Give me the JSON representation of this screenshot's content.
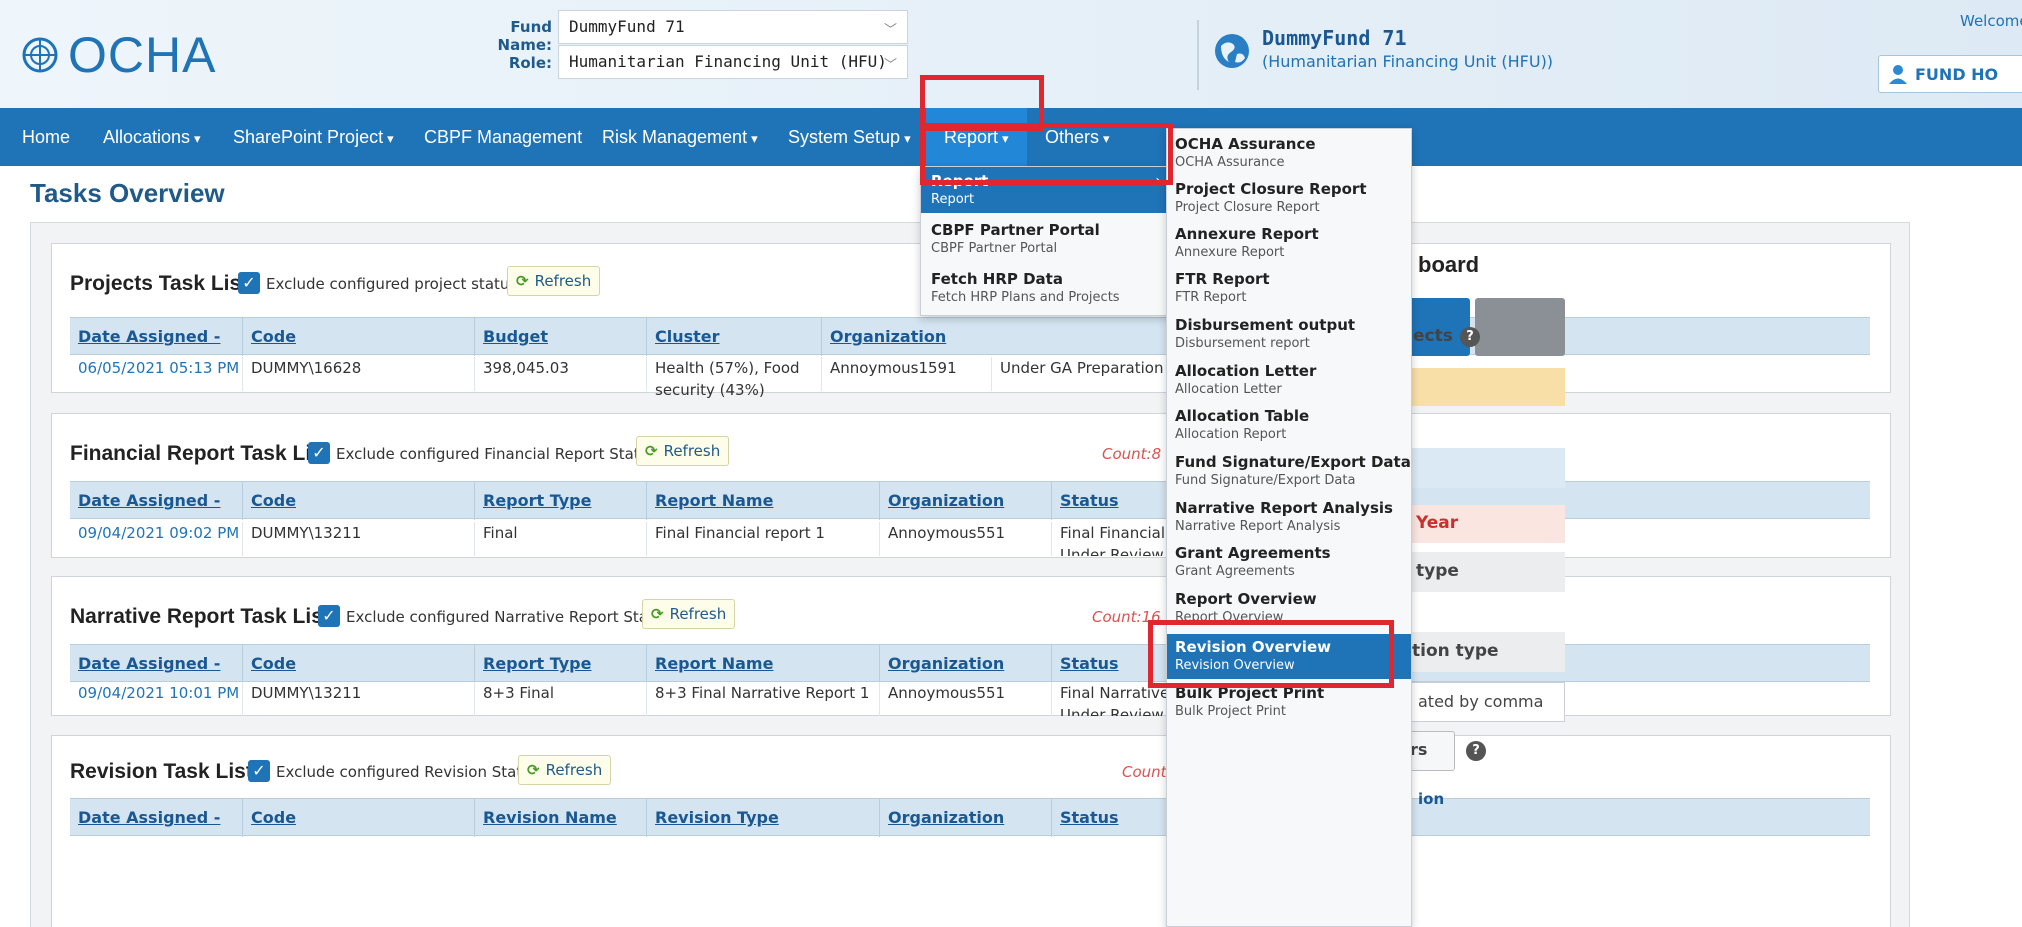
{
  "header": {
    "logo_text": "OCHA",
    "fund_name_label": "Fund Name:",
    "fund_name_value": "DummyFund 71",
    "role_label": "Role:",
    "role_value": "Humanitarian Financing Unit (HFU)",
    "fund_title": "DummyFund 71",
    "fund_role": "(Humanitarian Financing Unit (HFU))",
    "welcome": "Welcome",
    "fund_home": "FUND HO"
  },
  "nav": {
    "home": "Home",
    "allocations": "Allocations",
    "sharepoint": "SharePoint Project",
    "cbpf": "CBPF Management",
    "risk": "Risk Management",
    "system": "System Setup",
    "report": "Report",
    "others": "Others"
  },
  "page_title": "Tasks Overview",
  "projects": {
    "title": "Projects Task List",
    "exclude": "Exclude configured project statuses",
    "refresh": "Refresh",
    "headers": [
      "Date Assigned -",
      "Code",
      "Budget",
      "Cluster",
      "Organization"
    ],
    "row": {
      "date": "06/05/2021 05:13 PM",
      "code": "DUMMY\\16628",
      "budget": "398,045.03",
      "cluster_line1": "Health (57%), Food",
      "cluster_line2": "security (43%)",
      "org": "Annoymous1591",
      "status": "Under GA Preparation"
    }
  },
  "financial": {
    "title": "Financial Report Task List",
    "exclude": "Exclude configured Financial Report Statuses",
    "refresh": "Refresh",
    "count": "Count:8",
    "headers": [
      "Date Assigned -",
      "Code",
      "Report Type",
      "Report Name",
      "Organization",
      "Status"
    ],
    "row": {
      "date": "09/04/2021 09:02 PM",
      "code": "DUMMY\\13211",
      "type": "Final",
      "name": "Final Financial report 1",
      "org": "Annoymous551",
      "status_line1": "Final Financial Repo",
      "status_line2": "Under Review"
    }
  },
  "narrative": {
    "title": "Narrative Report Task List",
    "exclude": "Exclude configured Narrative Report Statuses",
    "refresh": "Refresh",
    "count": "Count:16",
    "headers": [
      "Date Assigned -",
      "Code",
      "Report Type",
      "Report Name",
      "Organization",
      "Status"
    ],
    "row": {
      "date": "09/04/2021 10:01 PM",
      "code": "DUMMY\\13211",
      "type": "8+3 Final",
      "name": "8+3 Final Narrative Report 1",
      "org": "Annoymous551",
      "status_line1": "Final Narrative Rep",
      "status_line2": "Under Review"
    }
  },
  "revision": {
    "title": "Revision Task List",
    "exclude": "Exclude configured Revision Statuses",
    "refresh": "Refresh",
    "count": "Count:",
    "headers": [
      "Date Assigned -",
      "Code",
      "Revision Name",
      "Revision Type",
      "Organization",
      "Status"
    ]
  },
  "dashboard": {
    "title": "board",
    "projects": "ects",
    "year": "Year",
    "type": "type",
    "allocation_type": "tion type",
    "input_text": "ated by comma",
    "filters": "rs",
    "section": "ion"
  },
  "menu_l1": [
    {
      "title": "Report",
      "sub": "Report",
      "active": true
    },
    {
      "title": "CBPF Partner Portal",
      "sub": "CBPF Partner Portal"
    },
    {
      "title": "Fetch HRP Data",
      "sub": "Fetch HRP Plans and Projects"
    }
  ],
  "menu_l2": [
    {
      "title": "OCHA Assurance",
      "sub": "OCHA Assurance"
    },
    {
      "title": "Project Closure Report",
      "sub": "Project Closure Report"
    },
    {
      "title": "Annexure Report",
      "sub": "Annexure Report"
    },
    {
      "title": "FTR Report",
      "sub": "FTR Report"
    },
    {
      "title": "Disbursement output",
      "sub": "Disbursement report"
    },
    {
      "title": "Allocation Letter",
      "sub": "Allocation Letter"
    },
    {
      "title": "Allocation Table",
      "sub": "Allocation Report"
    },
    {
      "title": "Fund Signature/Export Data",
      "sub": "Fund Signature/Export Data"
    },
    {
      "title": "Narrative Report Analysis",
      "sub": "Narrative Report Analysis"
    },
    {
      "title": "Grant Agreements",
      "sub": "Grant Agreements"
    },
    {
      "title": "Report Overview",
      "sub": "Report Overview"
    },
    {
      "title": "Revision Overview",
      "sub": "Revision Overview",
      "active": true
    },
    {
      "title": "Bulk Project Print",
      "sub": "Bulk Project Print"
    }
  ]
}
